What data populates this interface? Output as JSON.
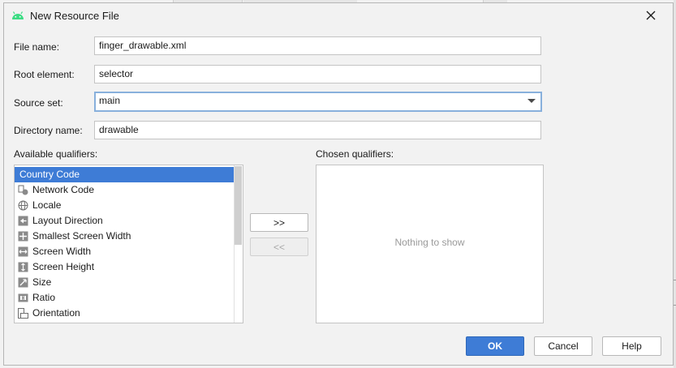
{
  "dialog": {
    "title": "New Resource File",
    "icon": "android-icon",
    "close_icon": "close-icon"
  },
  "form": {
    "file_name_label": "File name:",
    "file_name_value": "finger_drawable.xml",
    "root_element_label": "Root element:",
    "root_element_value": "selector",
    "source_set_label": "Source set:",
    "source_set_value": "main",
    "directory_name_label": "Directory name:",
    "directory_name_value": "drawable"
  },
  "qualifiers": {
    "available_label": "Available qualifiers:",
    "chosen_label": "Chosen qualifiers:",
    "empty_text": "Nothing to show",
    "items": [
      {
        "label": "Country Code",
        "icon": "country-code-icon",
        "selected": true
      },
      {
        "label": "Network Code",
        "icon": "network-code-icon",
        "selected": false
      },
      {
        "label": "Locale",
        "icon": "globe-icon",
        "selected": false
      },
      {
        "label": "Layout Direction",
        "icon": "layout-direction-icon",
        "selected": false
      },
      {
        "label": "Smallest Screen Width",
        "icon": "smallest-width-icon",
        "selected": false
      },
      {
        "label": "Screen Width",
        "icon": "screen-width-icon",
        "selected": false
      },
      {
        "label": "Screen Height",
        "icon": "screen-height-icon",
        "selected": false
      },
      {
        "label": "Size",
        "icon": "size-icon",
        "selected": false
      },
      {
        "label": "Ratio",
        "icon": "ratio-icon",
        "selected": false
      },
      {
        "label": "Orientation",
        "icon": "orientation-icon",
        "selected": false
      }
    ]
  },
  "transfer": {
    "add_label": ">>",
    "remove_label": "<<"
  },
  "buttons": {
    "ok": "OK",
    "cancel": "Cancel",
    "help": "Help"
  },
  "colors": {
    "accent": "#3e7cd6",
    "focus_border": "#88b0dc",
    "android_green": "#3ddc84"
  }
}
